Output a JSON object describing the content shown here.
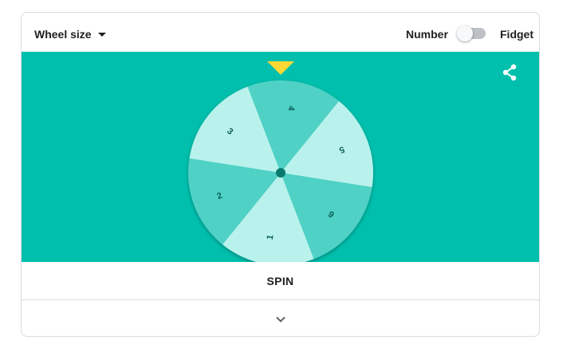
{
  "toolbar": {
    "wheel_size_label": "Wheel size",
    "mode_number_label": "Number",
    "mode_fidget_label": "Fidget",
    "toggle_state": "off"
  },
  "wheel": {
    "segments": [
      {
        "label": "4",
        "color": "#4fd1c5"
      },
      {
        "label": "5",
        "color": "#b9f2ec"
      },
      {
        "label": "6",
        "color": "#4fd1c5"
      },
      {
        "label": "1",
        "color": "#b9f2ec"
      },
      {
        "label": "2",
        "color": "#4fd1c5"
      },
      {
        "label": "3",
        "color": "#b9f2ec"
      }
    ],
    "pointer_color": "#fdd835",
    "hub_color": "#0a7a6e",
    "label_color": "#0b5f57",
    "background_color": "#00bfad"
  },
  "actions": {
    "share_icon": "share-icon",
    "spin_label": "SPIN",
    "expand_icon": "chevron-down-icon"
  }
}
